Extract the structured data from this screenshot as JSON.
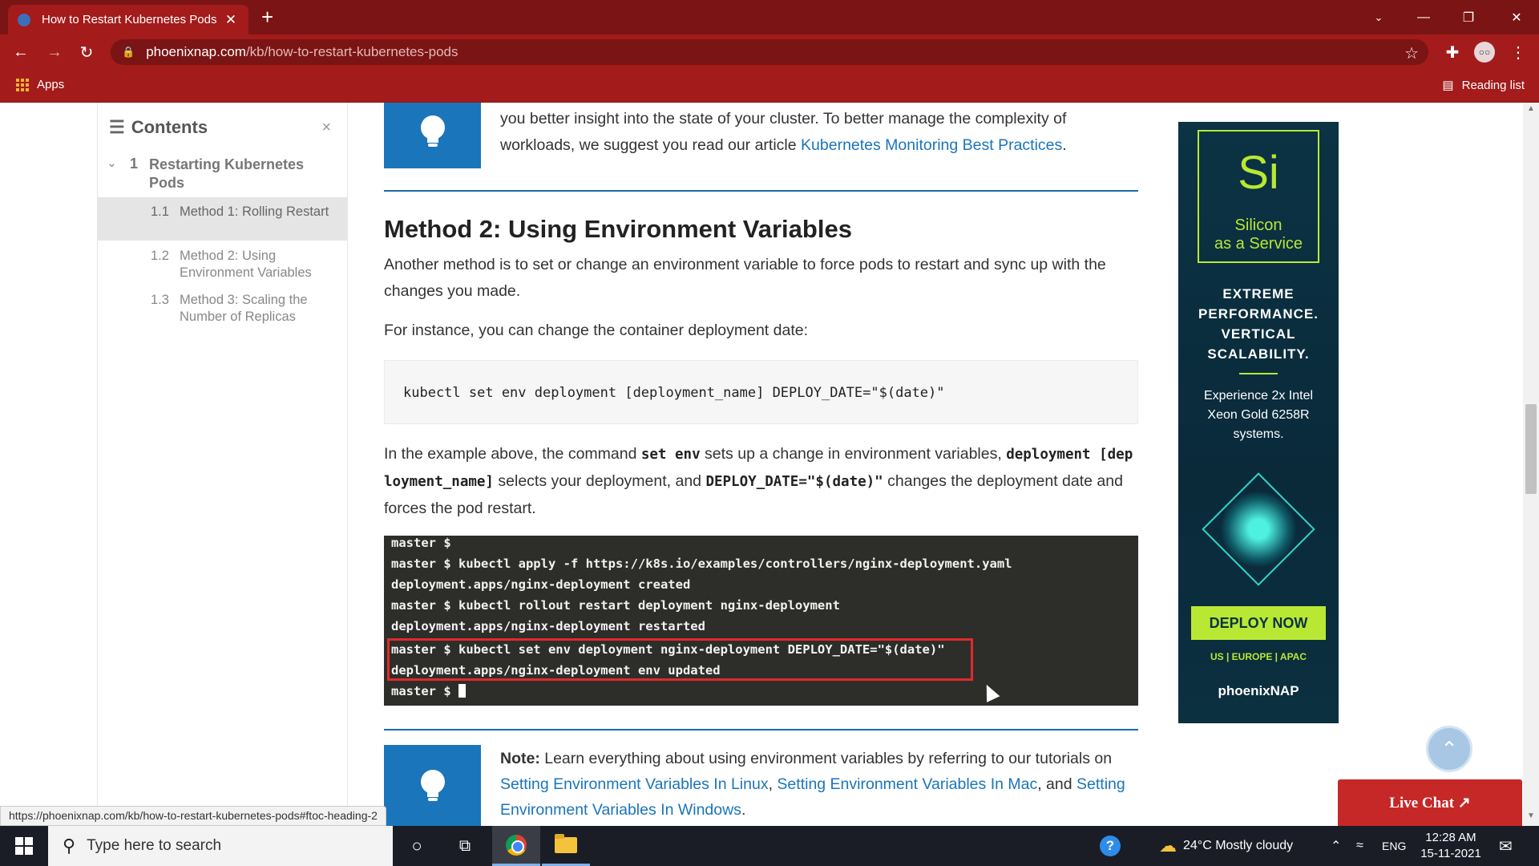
{
  "browser": {
    "tab_title": "How to Restart Kubernetes Pods",
    "tab_close": "✕",
    "new_tab": "+",
    "url_host": "phoenixnap.com",
    "url_path": "/kb/how-to-restart-kubernetes-pods",
    "apps_label": "Apps",
    "reading_list_label": "Reading list",
    "status_url": "https://phoenixnap.com/kb/how-to-restart-kubernetes-pods#ftoc-heading-2"
  },
  "toc": {
    "title": "Contents",
    "close": "×",
    "section": {
      "number": "1",
      "label": "Restarting Kubernetes Pods"
    },
    "items": [
      {
        "number": "1.1",
        "label": "Method 1: Rolling Restart"
      },
      {
        "number": "1.2",
        "label": "Method 2: Using Environment Variables"
      },
      {
        "number": "1.3",
        "label": "Method 3: Scaling the Number of Replicas"
      }
    ]
  },
  "article": {
    "tip_text": "you better insight into the state of your cluster. To better manage the complexity of workloads, we suggest you read our article ",
    "tip_link": "Kubernetes Monitoring Best Practices",
    "tip_end": ".",
    "heading": "Method 2: Using Environment Variables",
    "para1": "Another method is to set or change an environment variable to force pods to restart and sync up with the changes you made.",
    "para2": "For instance, you can change the container deployment date:",
    "code": "kubectl set env deployment [deployment_name] DEPLOY_DATE=\"$(date)\"",
    "expl": {
      "t1": "In the example above, the command ",
      "c1": "set env",
      "t2": " sets up a change in environment variables, ",
      "c2": "deployment [deployment_name]",
      "t3": " selects your deployment, and ",
      "c3": "DEPLOY_DATE=\"$(date)\"",
      "t4": " changes the deployment date and forces the pod restart."
    },
    "terminal_lines": [
      "master $",
      "master $ kubectl apply -f https://k8s.io/examples/controllers/nginx-deployment.yaml",
      "deployment.apps/nginx-deployment created",
      "master $ kubectl rollout restart deployment nginx-deployment",
      "deployment.apps/nginx-deployment restarted",
      "master $ kubectl set env deployment nginx-deployment DEPLOY_DATE=\"$(date)\"",
      "deployment.apps/nginx-deployment env updated",
      "master $ "
    ],
    "note_label": "Note:",
    "note_text": " Learn everything about using environment variables by referring to our tutorials on ",
    "note_links": [
      "Setting Environment Variables In Linux",
      "Setting Environment Variables In Mac",
      "Setting Environment Variables In Windows"
    ],
    "note_sep1": ", ",
    "note_sep2": ", and ",
    "note_end": "."
  },
  "ad": {
    "logo": "Si",
    "tagline_1": "Silicon",
    "tagline_2": "as a Service",
    "headline": "EXTREME PERFORMANCE. VERTICAL SCALABILITY.",
    "body": "Experience 2x Intel Xeon Gold 6258R systems.",
    "cta": "DEPLOY NOW",
    "regions": "US | EUROPE | APAC",
    "brand": "phoenixNAP"
  },
  "live_chat": "Live Chat ↗",
  "taskbar": {
    "search_placeholder": "Type here to search",
    "weather": "24°C Mostly cloudy",
    "language": "ENG",
    "time": "12:28 AM",
    "date": "15-11-2021"
  },
  "colors": {
    "chrome_dark": "#7b1414",
    "chrome": "#a31b1b",
    "link": "#1a75bb",
    "ad_accent": "#b9e834"
  }
}
